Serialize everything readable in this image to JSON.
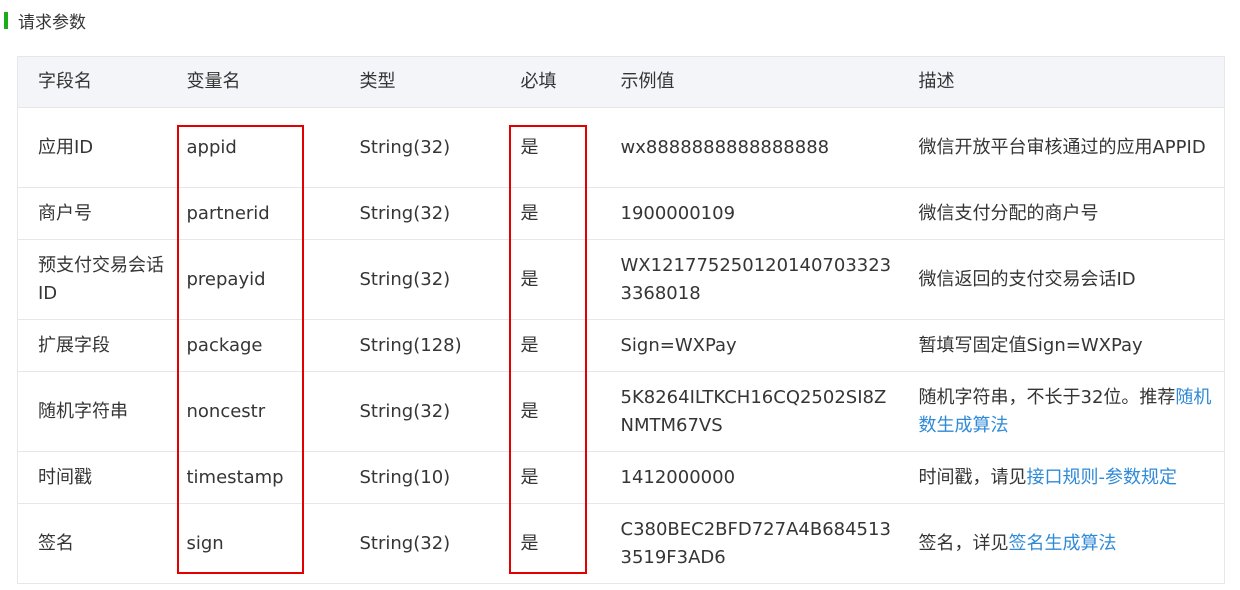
{
  "section": {
    "title": "请求参数"
  },
  "table": {
    "headers": [
      "字段名",
      "变量名",
      "类型",
      "必填",
      "示例值",
      "描述"
    ],
    "rows": [
      {
        "field": "应用ID",
        "variable": "appid",
        "type": "String(32)",
        "required": "是",
        "example": "wx8888888888888888",
        "desc": "微信开放平台审核通过的应用APPID",
        "desc_link": ""
      },
      {
        "field": "商户号",
        "variable": "partnerid",
        "type": "String(32)",
        "required": "是",
        "example": "1900000109",
        "desc": "微信支付分配的商户号",
        "desc_link": ""
      },
      {
        "field": "预支付交易会话ID",
        "variable": "prepayid",
        "type": "String(32)",
        "required": "是",
        "example": "WX1217752501201407033233368018",
        "desc": "微信返回的支付交易会话ID",
        "desc_link": ""
      },
      {
        "field": "扩展字段",
        "variable": "package",
        "type": "String(128)",
        "required": "是",
        "example": "Sign=WXPay",
        "desc": "暂填写固定值Sign=WXPay",
        "desc_link": ""
      },
      {
        "field": "随机字符串",
        "variable": "noncestr",
        "type": "String(32)",
        "required": "是",
        "example": "5K8264ILTKCH16CQ2502SI8ZNMTM67VS",
        "desc": "随机字符串，不长于32位。推荐",
        "desc_link": "随机数生成算法"
      },
      {
        "field": "时间戳",
        "variable": "timestamp",
        "type": "String(10)",
        "required": "是",
        "example": "1412000000",
        "desc": "时间戳，请见",
        "desc_link": "接口规则-参数规定"
      },
      {
        "field": "签名",
        "variable": "sign",
        "type": "String(32)",
        "required": "是",
        "example": "C380BEC2BFD727A4B6845133519F3AD6",
        "desc": "签名，详见",
        "desc_link": "签名生成算法"
      }
    ]
  },
  "annotation": {
    "box_color": "#e30000"
  }
}
